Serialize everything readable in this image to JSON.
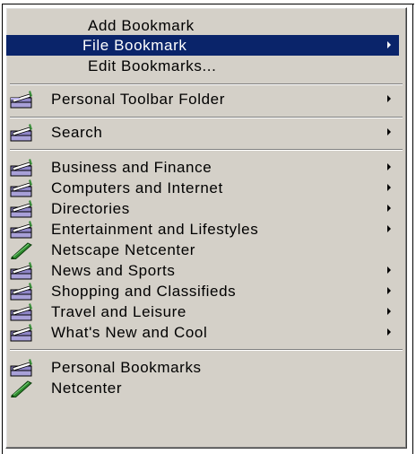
{
  "menu": {
    "top_items": [
      {
        "label": "Add Bookmark"
      },
      {
        "label": "File Bookmark",
        "has_submenu": true,
        "highlighted": true
      },
      {
        "label": "Edit Bookmarks..."
      }
    ],
    "toolbar_items": [
      {
        "label": "Personal Toolbar Folder",
        "icon": "folder-icon",
        "has_submenu": true
      }
    ],
    "search_items": [
      {
        "label": "Search",
        "icon": "folder-icon",
        "has_submenu": true
      }
    ],
    "category_items": [
      {
        "label": "Business and Finance",
        "icon": "folder-icon",
        "has_submenu": true
      },
      {
        "label": "Computers and Internet",
        "icon": "folder-icon",
        "has_submenu": true
      },
      {
        "label": "Directories",
        "icon": "folder-icon",
        "has_submenu": true
      },
      {
        "label": "Entertainment and Lifestyles",
        "icon": "folder-icon",
        "has_submenu": true
      },
      {
        "label": "Netscape Netcenter",
        "icon": "bookmark-icon",
        "has_submenu": false
      },
      {
        "label": "News and Sports",
        "icon": "folder-icon",
        "has_submenu": true
      },
      {
        "label": "Shopping and Classifieds",
        "icon": "folder-icon",
        "has_submenu": true
      },
      {
        "label": "Travel and Leisure",
        "icon": "folder-icon",
        "has_submenu": true
      },
      {
        "label": "What's New and Cool",
        "icon": "folder-icon",
        "has_submenu": true
      }
    ],
    "personal_items": [
      {
        "label": "Personal Bookmarks",
        "icon": "folder-icon",
        "has_submenu": false
      },
      {
        "label": "Netcenter",
        "icon": "bookmark-icon",
        "has_submenu": false
      }
    ]
  },
  "colors": {
    "menu_bg": "#d4d0c8",
    "highlight_bg": "#0a246a",
    "highlight_text": "#ffffff"
  }
}
